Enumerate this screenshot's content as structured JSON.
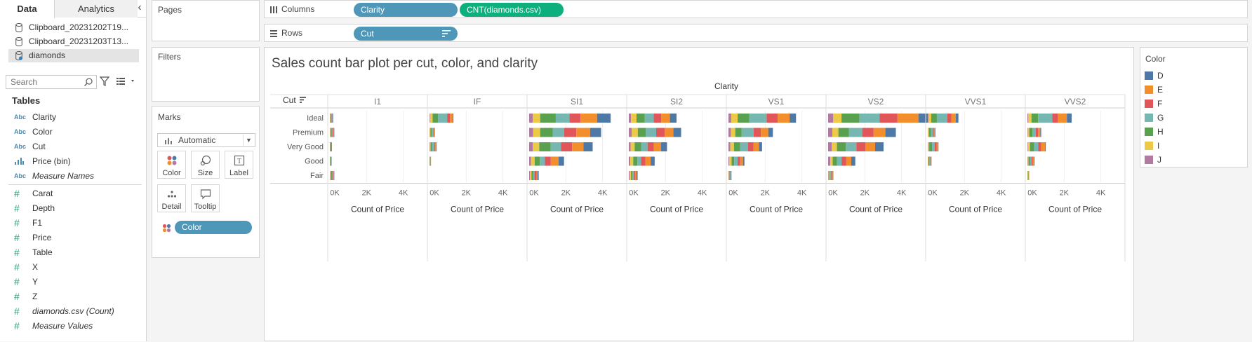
{
  "pane": {
    "tab_data": "Data",
    "tab_analytics": "Analytics",
    "datasources": [
      "Clipboard_20231202T19...",
      "Clipboard_20231203T13...",
      "diamonds"
    ],
    "search_placeholder": "Search",
    "tables_title": "Tables",
    "dimensions": [
      {
        "type": "Abc",
        "name": "Clarity"
      },
      {
        "type": "Abc",
        "name": "Color"
      },
      {
        "type": "Abc",
        "name": "Cut"
      },
      {
        "type": "bin",
        "name": "Price (bin)"
      },
      {
        "type": "Abc",
        "name": "Measure Names"
      }
    ],
    "measures": [
      "Carat",
      "Depth",
      "F1",
      "Price",
      "Table",
      "X",
      "Y",
      "Z",
      "diamonds.csv (Count)",
      "Measure Values"
    ]
  },
  "shelves": {
    "pages": "Pages",
    "filters": "Filters",
    "marks": "Marks",
    "mark_type": "Automatic",
    "mark_buttons": [
      "Color",
      "Size",
      "Label",
      "Detail",
      "Tooltip"
    ],
    "color_pill": "Color",
    "columns_label": "Columns",
    "columns_pills": [
      "Clarity",
      "CNT(diamonds.csv)"
    ],
    "rows_label": "Rows",
    "rows_pills": [
      "Cut"
    ]
  },
  "legend": {
    "title": "Color",
    "items": [
      {
        "label": "D",
        "color": "#4e79a7"
      },
      {
        "label": "E",
        "color": "#f28e2b"
      },
      {
        "label": "F",
        "color": "#e15759"
      },
      {
        "label": "G",
        "color": "#76b7b2"
      },
      {
        "label": "H",
        "color": "#59a14f"
      },
      {
        "label": "I",
        "color": "#edc948"
      },
      {
        "label": "J",
        "color": "#b07aa1"
      }
    ]
  },
  "chart_data": {
    "type": "bar",
    "title": "Sales count bar plot per cut, color, and clarity",
    "column_header": "Clarity",
    "row_header": "Cut",
    "xlabel": "Count of Price",
    "xticks": [
      "0K",
      "2K",
      "4K"
    ],
    "xlim": [
      0,
      5200
    ],
    "clarities": [
      "I1",
      "IF",
      "SI1",
      "SI2",
      "VS1",
      "VS2",
      "VVS1",
      "VVS2"
    ],
    "cuts": [
      "Ideal",
      "Premium",
      "Very Good",
      "Good",
      "Fair"
    ],
    "stack_order": [
      "J",
      "I",
      "H",
      "G",
      "F",
      "E",
      "D"
    ],
    "stack_colors": [
      "#b07aa1",
      "#edc948",
      "#59a14f",
      "#76b7b2",
      "#e15759",
      "#f28e2b",
      "#4e79a7"
    ],
    "values": {
      "I1": {
        "Ideal": [
          10,
          20,
          40,
          30,
          40,
          20,
          20
        ],
        "Premium": [
          20,
          40,
          50,
          40,
          40,
          30,
          20
        ],
        "Very Good": [
          10,
          10,
          20,
          20,
          20,
          10,
          10
        ],
        "Good": [
          0,
          10,
          20,
          10,
          20,
          10,
          10
        ],
        "Fair": [
          30,
          40,
          60,
          30,
          40,
          20,
          10
        ]
      },
      "IF": {
        "Ideal": [
          30,
          140,
          300,
          490,
          150,
          150,
          40
        ],
        "Premium": [
          10,
          40,
          70,
          80,
          40,
          30,
          20
        ],
        "Very Good": [
          20,
          40,
          80,
          120,
          60,
          50,
          20
        ],
        "Good": [
          10,
          10,
          10,
          20,
          10,
          10,
          0
        ],
        "Fair": [
          0,
          0,
          0,
          0,
          0,
          0,
          0
        ]
      },
      "SI1": {
        "Ideal": [
          200,
          400,
          850,
          750,
          600,
          900,
          740
        ],
        "Premium": [
          220,
          380,
          680,
          630,
          660,
          750,
          600
        ],
        "Very Good": [
          200,
          350,
          620,
          570,
          600,
          620,
          500
        ],
        "Good": [
          100,
          200,
          280,
          280,
          320,
          420,
          300
        ],
        "Fair": [
          40,
          90,
          90,
          70,
          110,
          60,
          60
        ]
      },
      "SI2": {
        "Ideal": [
          120,
          300,
          450,
          480,
          420,
          470,
          360
        ],
        "Premium": [
          160,
          330,
          440,
          560,
          470,
          470,
          420
        ],
        "Very Good": [
          100,
          220,
          350,
          350,
          340,
          400,
          320
        ],
        "Good": [
          80,
          160,
          230,
          200,
          240,
          280,
          220
        ],
        "Fair": [
          40,
          80,
          80,
          60,
          80,
          80,
          60
        ]
      },
      "VS1": {
        "Ideal": [
          150,
          350,
          630,
          950,
          600,
          650,
          350
        ],
        "Premium": [
          130,
          240,
          350,
          650,
          400,
          400,
          250
        ],
        "Very Good": [
          100,
          200,
          330,
          430,
          300,
          300,
          170
        ],
        "Good": [
          50,
          120,
          140,
          190,
          140,
          150,
          80
        ],
        "Fair": [
          20,
          20,
          30,
          40,
          20,
          10,
          10
        ]
      },
      "VS2": {
        "Ideal": [
          280,
          450,
          980,
          1100,
          970,
          1140,
          1020
        ],
        "Premium": [
          230,
          330,
          580,
          720,
          620,
          640,
          570
        ],
        "Very Good": [
          200,
          280,
          480,
          580,
          500,
          520,
          460
        ],
        "Good": [
          120,
          130,
          230,
          250,
          260,
          270,
          220
        ],
        "Fair": [
          30,
          50,
          40,
          50,
          50,
          40,
          20
        ]
      },
      "VVS1": {
        "Ideal": [
          30,
          160,
          300,
          580,
          210,
          250,
          140
        ],
        "Premium": [
          10,
          60,
          100,
          100,
          60,
          60,
          30
        ],
        "Very Good": [
          20,
          60,
          150,
          150,
          100,
          80,
          20
        ],
        "Good": [
          10,
          30,
          50,
          40,
          30,
          20,
          10
        ],
        "Fair": [
          0,
          0,
          0,
          0,
          0,
          0,
          0
        ]
      },
      "VVS2": {
        "Ideal": [
          50,
          170,
          360,
          770,
          320,
          480,
          260
        ],
        "Premium": [
          20,
          80,
          170,
          190,
          120,
          120,
          50
        ],
        "Very Good": [
          30,
          110,
          220,
          230,
          160,
          210,
          40
        ],
        "Good": [
          20,
          40,
          90,
          80,
          60,
          80,
          20
        ],
        "Fair": [
          0,
          20,
          20,
          20,
          10,
          10,
          0
        ]
      }
    }
  }
}
